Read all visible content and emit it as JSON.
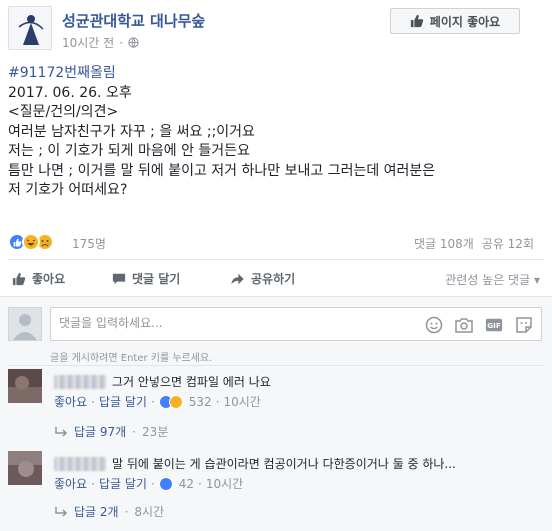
{
  "page": {
    "name": "성균관대학교 대나무숲",
    "time": "10시간 전",
    "like_page_label": "페이지 좋아요"
  },
  "post": {
    "tag": "#91172번째올림",
    "lines": [
      "2017. 06. 26. 오후",
      "<질문/건의/의견>",
      "여러분 남자친구가 자꾸 ; 을 써요 ;;이거요",
      "저는 ; 이 기호가 되게 마음에 안 들거든요",
      "틈만 나면 ; 이거를 말 뒤에 붙이고 저거 하나만 보내고 그러는데 여러분은",
      "저 기호가 어떠세요?"
    ]
  },
  "reactions": {
    "count": "175명",
    "comments": "댓글 108개",
    "shares": "공유 12회",
    "colors": {
      "like": "#4080ff",
      "haha": "#f7b125",
      "sad": "#f7b125"
    }
  },
  "actions": {
    "like": "좋아요",
    "comment": "댓글 달기",
    "share": "공유하기",
    "sort": "관련성 높은 댓글"
  },
  "composer": {
    "placeholder": "댓글을 입력하세요...",
    "hint": "글을 게시하려면 Enter 키를 누르세요.",
    "icons": [
      "emoji-icon",
      "camera-icon",
      "gif-icon",
      "sticker-icon"
    ]
  },
  "comments": [
    {
      "text": "그거 안넣으면 컴파일 에러 나요",
      "like_label": "좋아요",
      "reply_label": "답글 달기",
      "reaction_count": "532",
      "time": "10시간",
      "replies_label": "답글 97개",
      "replies_time": "23분"
    },
    {
      "text": "말 뒤에 붙이는 게 습관이라면 컴공이거나 다한증이거나 둘 중 하나...",
      "like_label": "좋아요",
      "reply_label": "답글 달기",
      "reaction_count": "42",
      "time": "10시간",
      "replies_label": "답글 2개",
      "replies_time": "8시간"
    }
  ]
}
